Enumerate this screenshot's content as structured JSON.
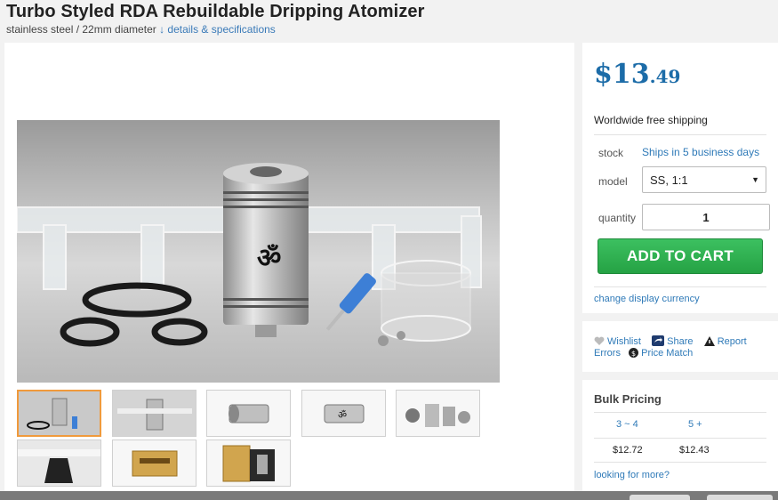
{
  "product": {
    "title": "Turbo Styled RDA Rebuildable Dripping Atomizer",
    "subtitle": "stainless steel / 22mm diameter",
    "details_link": "↓ details & specifications"
  },
  "price": {
    "dollars": "$13",
    "cents": ".49"
  },
  "shipping_text": "Worldwide free shipping",
  "options": {
    "stock_label": "stock",
    "stock_value": "Ships in 5 business days",
    "model_label": "model",
    "model_value": "SS, 1:1",
    "quantity_label": "quantity",
    "quantity_value": "1"
  },
  "cart_button": "ADD TO CART",
  "currency_link": "change display currency",
  "actions": {
    "wishlist": "Wishlist",
    "share": "Share",
    "report": "Report",
    "errors": "Errors",
    "price_match": "Price Match"
  },
  "bulk": {
    "title": "Bulk Pricing",
    "tiers": [
      {
        "qty": "3 ~ 4",
        "price": "$12.72"
      },
      {
        "qty": "5 +",
        "price": "$12.43"
      }
    ],
    "more_link": "looking for more?"
  },
  "colors": {
    "price": "#1c6ca8",
    "cart": "#2eae4e",
    "link": "#2f7ab8",
    "active_thumb": "#f09a3c"
  }
}
